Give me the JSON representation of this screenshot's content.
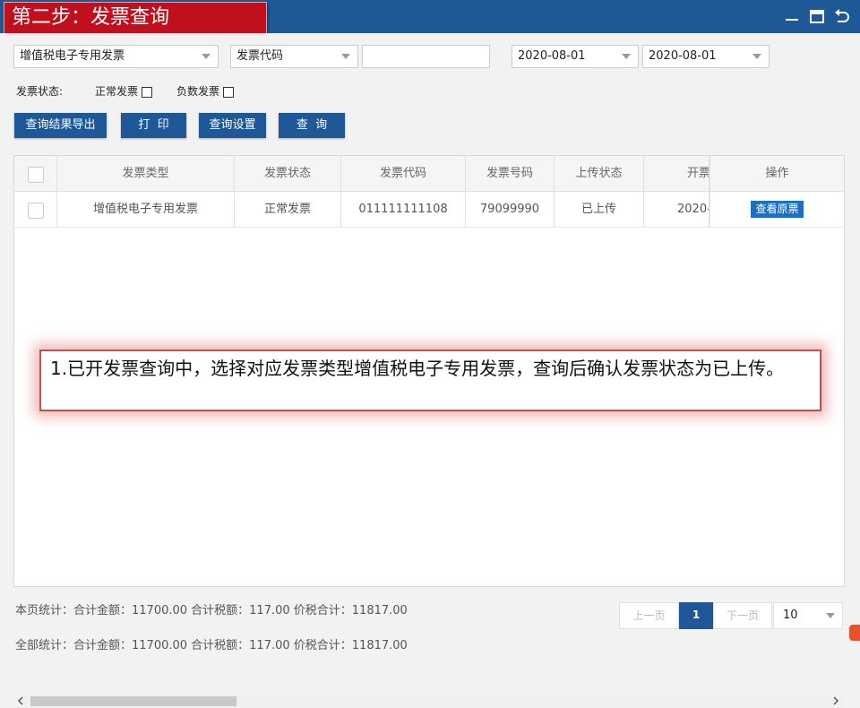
{
  "header": {
    "step_title": "第二步：发票查询"
  },
  "filters": {
    "invoice_type": "增值税电子专用发票",
    "field_select": "发票代码",
    "field_value": "",
    "date_from": "2020-08-01",
    "date_to": "2020-08-01"
  },
  "status": {
    "label": "发票状态:",
    "normal": "正常发票",
    "negative": "负数发票"
  },
  "buttons": {
    "export": "查询结果导出",
    "print": "打  印",
    "settings": "查询设置",
    "query": "查  询"
  },
  "table": {
    "columns": [
      "发票类型",
      "发票状态",
      "发票代码",
      "发票号码",
      "上传状态",
      "开票",
      "操作"
    ],
    "rows": [
      {
        "type": "增值税电子专用发票",
        "status": "正常发票",
        "code": "011111111108",
        "number": "79099990",
        "upload": "已上传",
        "date": "2020-",
        "action": "查看原票"
      }
    ]
  },
  "callout": {
    "text": "1.已开发票查询中，选择对应发票类型增值税电子专用发票，查询后确认发票状态为已上传。"
  },
  "footer": {
    "page_stats": "本页统计：合计金额：11700.00  合计税额：117.00    价税合计：11817.00",
    "all_stats": "全部统计：合计金额：11700.00  合计税额：117.00    价税合计：11817.00"
  },
  "pagination": {
    "prev": "上一页",
    "current": "1",
    "next": "下一页",
    "page_size": "10"
  },
  "colors": {
    "header_bg": "#1e5896",
    "step_red": "#c0101d",
    "button_blue": "#1e5896",
    "view_button": "#1e6fbf"
  }
}
